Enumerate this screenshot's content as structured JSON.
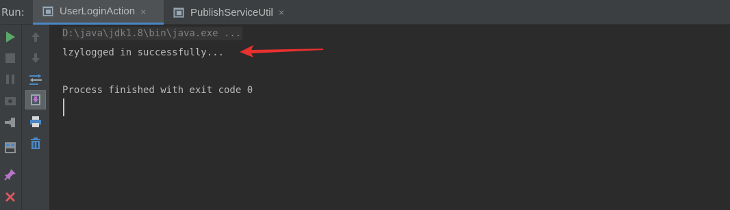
{
  "run_panel": {
    "label": "Run:",
    "tabs": [
      {
        "label": "UserLoginAction",
        "active": true,
        "icon": "run-config-icon"
      },
      {
        "label": "PublishServiceUtil",
        "active": false,
        "icon": "run-config-icon"
      }
    ],
    "close_glyph": "×"
  },
  "toolbar": {
    "left": [
      "rerun-icon",
      "stop-icon",
      "pause-icon",
      "dump-threads-icon",
      "exit-icon",
      "layout-icon",
      "pin-icon",
      "close-icon"
    ],
    "right": [
      "scroll-up-icon",
      "scroll-down-icon",
      "soft-wrap-icon",
      "scroll-to-end-icon",
      "print-icon",
      "clear-all-icon"
    ]
  },
  "console": {
    "command": "D:\\java\\jdk1.8\\bin\\java.exe ...",
    "output_line": "lzylogged in successfully...",
    "exit_message": "Process finished with exit code 0"
  },
  "colors": {
    "accent": "#4a88c7",
    "annotation_arrow": "#e8312f",
    "run_green": "#59a869",
    "close_red": "#db5860"
  }
}
